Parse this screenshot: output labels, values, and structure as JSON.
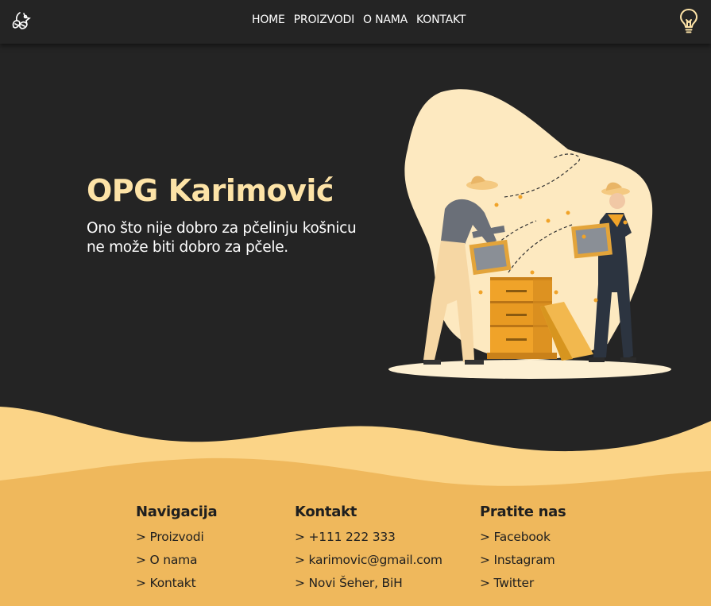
{
  "nav": {
    "links": [
      "HOME",
      "PROIZVODI",
      "O NAMA",
      "KONTAKT"
    ]
  },
  "hero": {
    "title": "OPG Karimović",
    "subtitle_line1": "Ono što nije dobro za pčelinju košnicu",
    "subtitle_line2": "ne može biti dobro za pčele."
  },
  "footer": {
    "navigation": {
      "heading": "Navigacija",
      "items": [
        "> Proizvodi",
        "> O nama",
        "> Kontakt"
      ]
    },
    "contact": {
      "heading": "Kontakt",
      "items": [
        "> +111 222 333",
        "> karimovic@gmail.com",
        "> Novi Šeher, BiH"
      ]
    },
    "social": {
      "heading": "Pratite nas",
      "items": [
        "> Facebook",
        "> Instagram",
        "> Twitter"
      ]
    }
  },
  "colors": {
    "background": "#242424",
    "accent_light": "#fde3a7",
    "wave_light": "#fbd487",
    "wave_main": "#efb85c"
  },
  "icons": {
    "logo": "bee-flower-icon",
    "theme_toggle": "lightbulb-icon"
  }
}
